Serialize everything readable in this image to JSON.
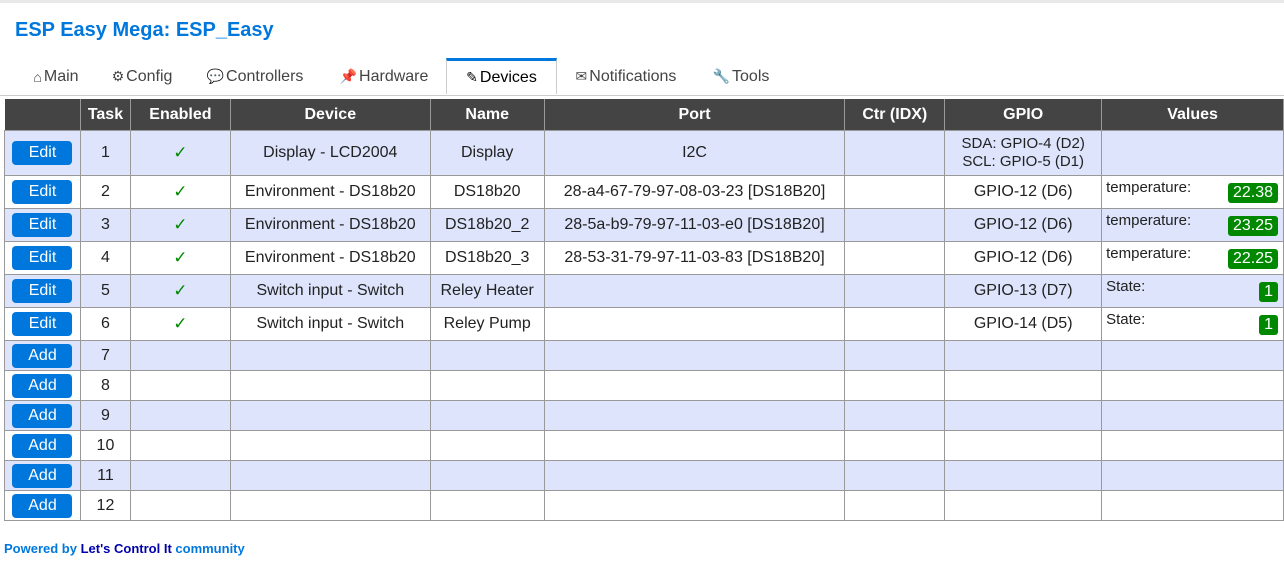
{
  "app_title": "ESP Easy Mega: ESP_Easy",
  "tabs": [
    {
      "icon": "⌂",
      "label": "Main",
      "active": false
    },
    {
      "icon": "⚙",
      "label": "Config",
      "active": false
    },
    {
      "icon": "💬",
      "label": "Controllers",
      "active": false
    },
    {
      "icon": "📌",
      "label": "Hardware",
      "active": false
    },
    {
      "icon": "✎",
      "label": "Devices",
      "active": true
    },
    {
      "icon": "✉",
      "label": "Notifications",
      "active": false
    },
    {
      "icon": "🔧",
      "label": "Tools",
      "active": false
    }
  ],
  "table": {
    "headers": [
      "",
      "Task",
      "Enabled",
      "Device",
      "Name",
      "Port",
      "Ctr (IDX)",
      "GPIO",
      "Values"
    ],
    "rows": [
      {
        "button": "Edit",
        "task": "1",
        "enabled": "✓",
        "device": "Display - LCD2004",
        "name": "Display",
        "port": "I2C",
        "ctr": "",
        "gpio": [
          "SDA: GPIO-4 (D2)",
          "SCL: GPIO-5 (D1)"
        ],
        "value_name": "",
        "value": ""
      },
      {
        "button": "Edit",
        "task": "2",
        "enabled": "✓",
        "device": "Environment - DS18b20",
        "name": "DS18b20",
        "port": "28-a4-67-79-97-08-03-23 [DS18B20]",
        "ctr": "",
        "gpio": [
          "GPIO-12 (D6)"
        ],
        "value_name": "temperature:",
        "value": "22.38"
      },
      {
        "button": "Edit",
        "task": "3",
        "enabled": "✓",
        "device": "Environment - DS18b20",
        "name": "DS18b20_2",
        "port": "28-5a-b9-79-97-11-03-e0 [DS18B20]",
        "ctr": "",
        "gpio": [
          "GPIO-12 (D6)"
        ],
        "value_name": "temperature:",
        "value": "23.25"
      },
      {
        "button": "Edit",
        "task": "4",
        "enabled": "✓",
        "device": "Environment - DS18b20",
        "name": "DS18b20_3",
        "port": "28-53-31-79-97-11-03-83 [DS18B20]",
        "ctr": "",
        "gpio": [
          "GPIO-12 (D6)"
        ],
        "value_name": "temperature:",
        "value": "22.25"
      },
      {
        "button": "Edit",
        "task": "5",
        "enabled": "✓",
        "device": "Switch input - Switch",
        "name": "Reley Heater",
        "port": "",
        "ctr": "",
        "gpio": [
          "GPIO-13 (D7)"
        ],
        "value_name": "State:",
        "value": "1"
      },
      {
        "button": "Edit",
        "task": "6",
        "enabled": "✓",
        "device": "Switch input - Switch",
        "name": "Reley Pump",
        "port": "",
        "ctr": "",
        "gpio": [
          "GPIO-14 (D5)"
        ],
        "value_name": "State:",
        "value": "1"
      },
      {
        "button": "Add",
        "task": "7"
      },
      {
        "button": "Add",
        "task": "8"
      },
      {
        "button": "Add",
        "task": "9"
      },
      {
        "button": "Add",
        "task": "10"
      },
      {
        "button": "Add",
        "task": "11"
      },
      {
        "button": "Add",
        "task": "12"
      }
    ]
  },
  "footer": {
    "prefix": "Powered by ",
    "link": "Let's Control It",
    "suffix": " community"
  },
  "colors": {
    "accent": "#0077DD",
    "header_bg": "#444444",
    "odd_row": "#DDE4FB",
    "value_badge": "#008800"
  }
}
